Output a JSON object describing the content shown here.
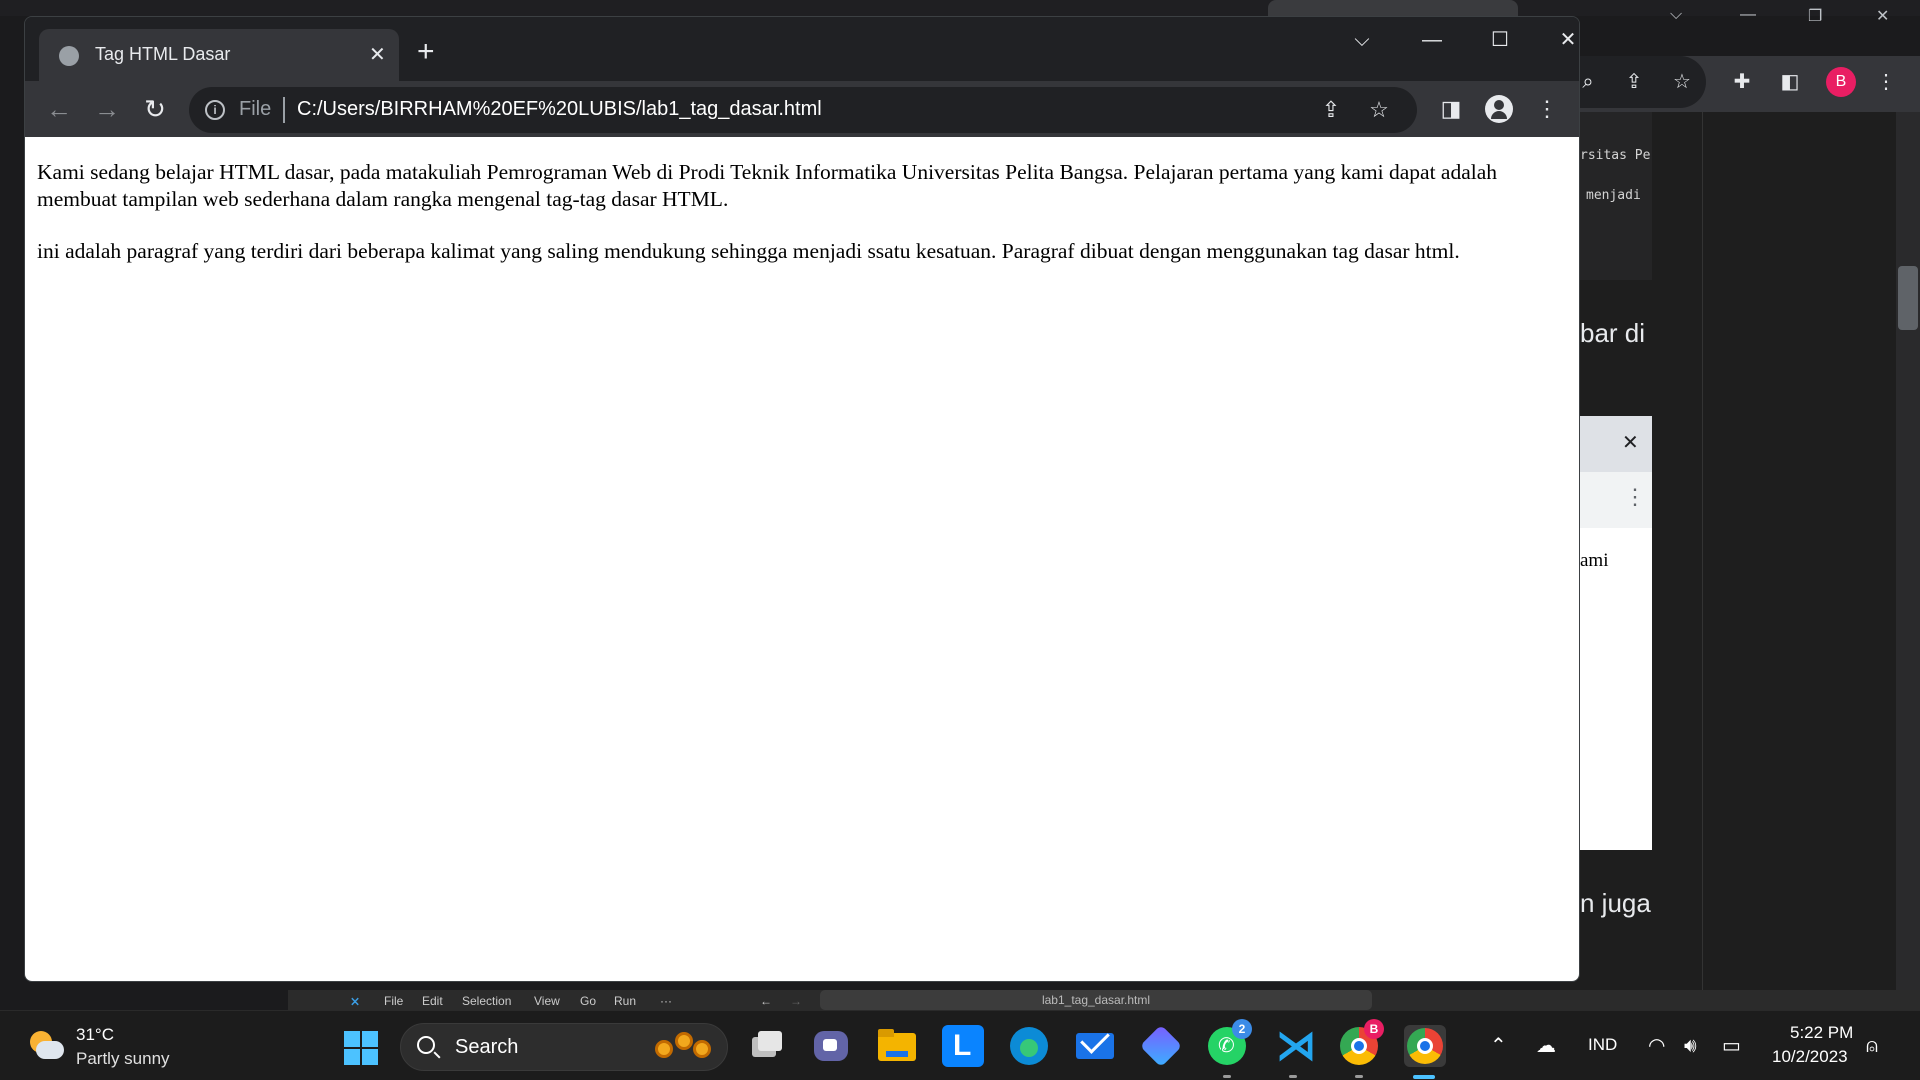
{
  "browser": {
    "tab": {
      "title": "Tag HTML Dasar"
    },
    "address": {
      "scheme": "File",
      "url": "C:/Users/BIRRHAM%20EF%20LUBIS/lab1_tag_dasar.html"
    },
    "profile_initial": "B"
  },
  "page": {
    "paragraphs": [
      "Kami sedang belajar HTML dasar, pada matakuliah Pemrograman Web di Prodi Teknik Informatika Universitas Pelita Bangsa. Pelajaran pertama yang kami dapat adalah membuat tampilan web sederhana dalam rangka mengenal tag-tag dasar HTML.",
      "ini adalah paragraf yang terdiri dari beberapa kalimat yang saling mendukung sehingga menjadi ssatu kesatuan. Paragraf dibuat dengan menggunakan tag dasar html."
    ]
  },
  "background": {
    "code_lines": [
      "rsitas Pe",
      "menjadi"
    ],
    "text_1": "bar di",
    "text_2": "n juga",
    "dialog_text": "ami",
    "vscode_menu": [
      "File",
      "Edit",
      "Selection",
      "View",
      "Go",
      "Run",
      "···"
    ],
    "vscode_search": "lab1_tag_dasar.html"
  },
  "taskbar": {
    "weather": {
      "temp": "31°C",
      "desc": "Partly sunny"
    },
    "search_label": "Search",
    "badges": {
      "whatsapp": "2",
      "chrome_profile": "B"
    },
    "language": "IND",
    "time": "5:22 PM",
    "date": "10/2/2023"
  },
  "colors": {
    "accent": "#4cc2ff",
    "profile": "#e91e63",
    "chrome_bg": "#202124",
    "toolbar": "#35363a"
  }
}
